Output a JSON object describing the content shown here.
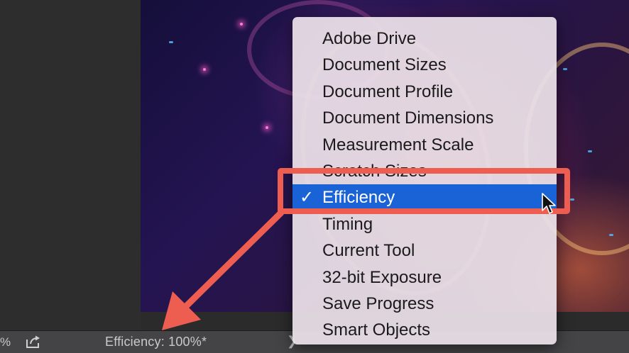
{
  "status_bar": {
    "zoom_fragment": "%",
    "share_icon": "share-export-icon",
    "info_text": "Efficiency: 100%*",
    "arrow_glyph": "❯"
  },
  "menu": {
    "items": [
      {
        "label": "Adobe Drive",
        "checked": false
      },
      {
        "label": "Document Sizes",
        "checked": false
      },
      {
        "label": "Document Profile",
        "checked": false
      },
      {
        "label": "Document Dimensions",
        "checked": false
      },
      {
        "label": "Measurement Scale",
        "checked": false
      },
      {
        "label": "Scratch Sizes",
        "checked": false
      },
      {
        "label": "Efficiency",
        "checked": true
      },
      {
        "label": "Timing",
        "checked": false
      },
      {
        "label": "Current Tool",
        "checked": false
      },
      {
        "label": "32-bit Exposure",
        "checked": false
      },
      {
        "label": "Save Progress",
        "checked": false
      },
      {
        "label": "Smart Objects",
        "checked": false
      }
    ],
    "check_glyph": "✓"
  },
  "colors": {
    "selection": "#1a63d6",
    "annotation": "#ee5e50",
    "menu_background": "#ece2ea",
    "status_bar": "#444446"
  }
}
